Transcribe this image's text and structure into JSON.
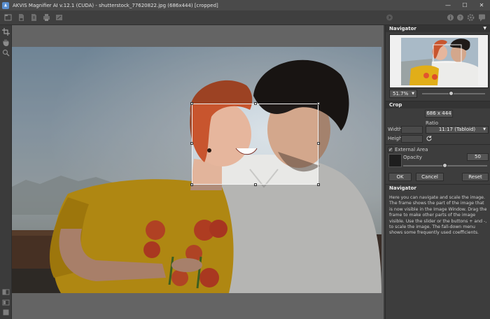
{
  "window": {
    "title": "AKVIS Magnifier AI v.12.1 (CUDA) - shutterstock_77620822.jpg (686x444) [cropped]",
    "minimize_glyph": "—",
    "maximize_glyph": "☐",
    "close_glyph": "✕"
  },
  "toolbar": {
    "left_icons": [
      "open-icon",
      "save-icon",
      "batch-icon",
      "print-icon",
      "share-icon"
    ],
    "right_icons": [
      "run-icon",
      "info-icon",
      "help-icon",
      "settings-icon",
      "notifications-icon"
    ]
  },
  "tools": [
    "crop-tool-icon",
    "hand-tool-icon",
    "zoom-tool-icon",
    "before-after-icon",
    "panel-toggle-icon",
    "fit-icon"
  ],
  "navigator": {
    "title": "Navigator",
    "zoom": "51.7%",
    "zoom_slider_value": 0.47
  },
  "crop": {
    "title": "Crop",
    "size": "686 x 444",
    "ratio_label": "Ratio",
    "width_label": "Width",
    "height_label": "Height",
    "width_value": "",
    "height_value": "",
    "ratio_value": "11:17 (Tabloid)",
    "external_area_label": "External Area",
    "external_area_checked": "✓",
    "opacity_label": "Opacity",
    "opacity_value": "50",
    "opacity_fraction": 0.5,
    "ok_label": "OK",
    "cancel_label": "Cancel",
    "reset_label": "Reset"
  },
  "help": {
    "title": "Navigator",
    "text": "Here you can navigate and scale the image. The frame shows the part of the image that is now visible in the Image Window. Drag the frame to make other parts of the image visible. Use the slider or the buttons + and -, to scale the image. The fall-down menu shows some frequently used coefficients."
  },
  "colors": {
    "accent": "#f2f2f2",
    "panel_bg": "#3d3d3d",
    "canvas_bg": "#646464"
  }
}
